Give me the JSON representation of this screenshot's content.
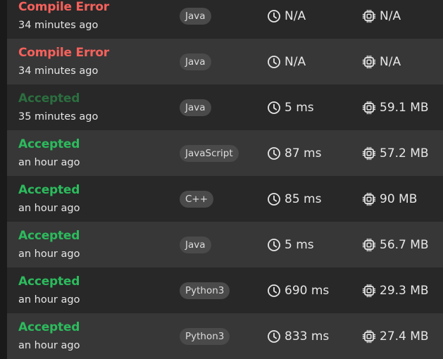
{
  "submissions": [
    {
      "status": "Compile Error",
      "status_type": "error",
      "time_ago": "34 minutes ago",
      "language": "Java",
      "runtime": "N/A",
      "memory": "N/A"
    },
    {
      "status": "Compile Error",
      "status_type": "error",
      "time_ago": "34 minutes ago",
      "language": "Java",
      "runtime": "N/A",
      "memory": "N/A"
    },
    {
      "status": "Accepted",
      "status_type": "accepted-dim",
      "time_ago": "35 minutes ago",
      "language": "Java",
      "runtime": "5 ms",
      "memory": "59.1 MB"
    },
    {
      "status": "Accepted",
      "status_type": "accepted",
      "time_ago": "an hour ago",
      "language": "JavaScript",
      "runtime": "87 ms",
      "memory": "57.2 MB"
    },
    {
      "status": "Accepted",
      "status_type": "accepted",
      "time_ago": "an hour ago",
      "language": "C++",
      "runtime": "85 ms",
      "memory": "90 MB"
    },
    {
      "status": "Accepted",
      "status_type": "accepted",
      "time_ago": "an hour ago",
      "language": "Java",
      "runtime": "5 ms",
      "memory": "56.7 MB"
    },
    {
      "status": "Accepted",
      "status_type": "accepted",
      "time_ago": "an hour ago",
      "language": "Python3",
      "runtime": "690 ms",
      "memory": "29.3 MB"
    },
    {
      "status": "Accepted",
      "status_type": "accepted",
      "time_ago": "an hour ago",
      "language": "Python3",
      "runtime": "833 ms",
      "memory": "27.4 MB"
    }
  ],
  "icons": {
    "runtime": "clock-icon",
    "memory": "cpu-chip-icon"
  },
  "colors": {
    "error": "#f8615c",
    "accepted": "#2cbb5d",
    "accepted_dim": "#2b6e3f",
    "row_dark": "#282828",
    "row_light": "#373737",
    "badge": "#4a4a4a"
  }
}
